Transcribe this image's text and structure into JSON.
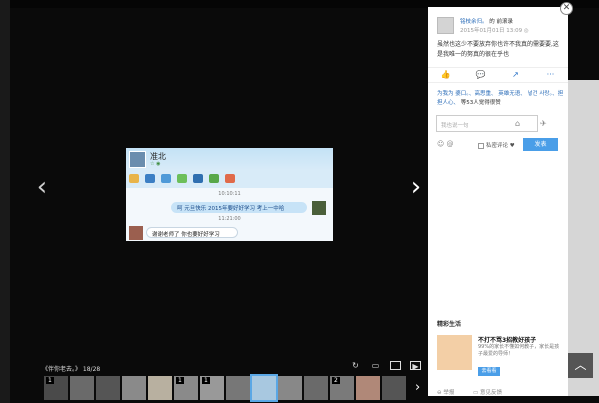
{
  "viewer": {
    "prev_arrow": "‹",
    "next_arrow": "›",
    "album_label": "《伴你老去。》 18/28",
    "strip_next": "›"
  },
  "photo": {
    "contact_name": "准北",
    "status_icons": "☆ ◉",
    "timestamp_1": "10:10:11",
    "message_1": "呵 元旦快乐 2015年要好好学习 考上一中哈",
    "timestamp_2": "11:21:00",
    "message_2": "谢谢老师了  你也要好好学习"
  },
  "thumbnails": [
    {
      "num": "1",
      "color": "#4a4a4a"
    },
    {
      "num": "",
      "color": "#6a6a6a"
    },
    {
      "num": "",
      "color": "#555"
    },
    {
      "num": "",
      "color": "#8a8a8a"
    },
    {
      "num": "",
      "color": "#b8b0a0"
    },
    {
      "num": "1",
      "color": "#8a8a8a"
    },
    {
      "num": "1",
      "color": "#999"
    },
    {
      "num": "",
      "color": "#777"
    },
    {
      "num": "",
      "color": "#a8c8e0",
      "selected": true
    },
    {
      "num": "",
      "color": "#888"
    },
    {
      "num": "",
      "color": "#6a6a6a"
    },
    {
      "num": "2",
      "color": "#7a7a7a"
    },
    {
      "num": "",
      "color": "#b08878"
    },
    {
      "num": "",
      "color": "#555"
    }
  ],
  "controls": {
    "rotate": "↻",
    "fit": "▭",
    "full": "□",
    "play": "▶"
  },
  "panel": {
    "close": "✕",
    "username": "铭枝余归。",
    "role": "的 前滚录",
    "time": "2015年01月01日 13:09 ◎",
    "text": "虽然也这少不要放弃你也许不我真的需要要,这是我唯一的努真的很在乎也",
    "actions": [
      "👍",
      "💬",
      "↗",
      "···"
    ],
    "likes": "为我为 婆口。、高思重、 英雄无语、 넣건 사랑。、担担人心、",
    "likes_suffix": "等53人觉得很赞",
    "comment_placeholder": "我也说一句",
    "camera": "⌂",
    "at": "✈",
    "emoji": "☺ @",
    "private_label": "私密评论 ♥",
    "send_label": "发表",
    "rec_title": "精彩生活",
    "rec_head": "不打不骂3招教好孩子",
    "rec_desc": "99%的家长不懂如何教子，家长是孩子最爱的导师！",
    "rec_btn": "去看看",
    "foot_report": "⊖ 举报",
    "foot_feedback": "▭ 意见反馈"
  },
  "scroll_up": "︿"
}
